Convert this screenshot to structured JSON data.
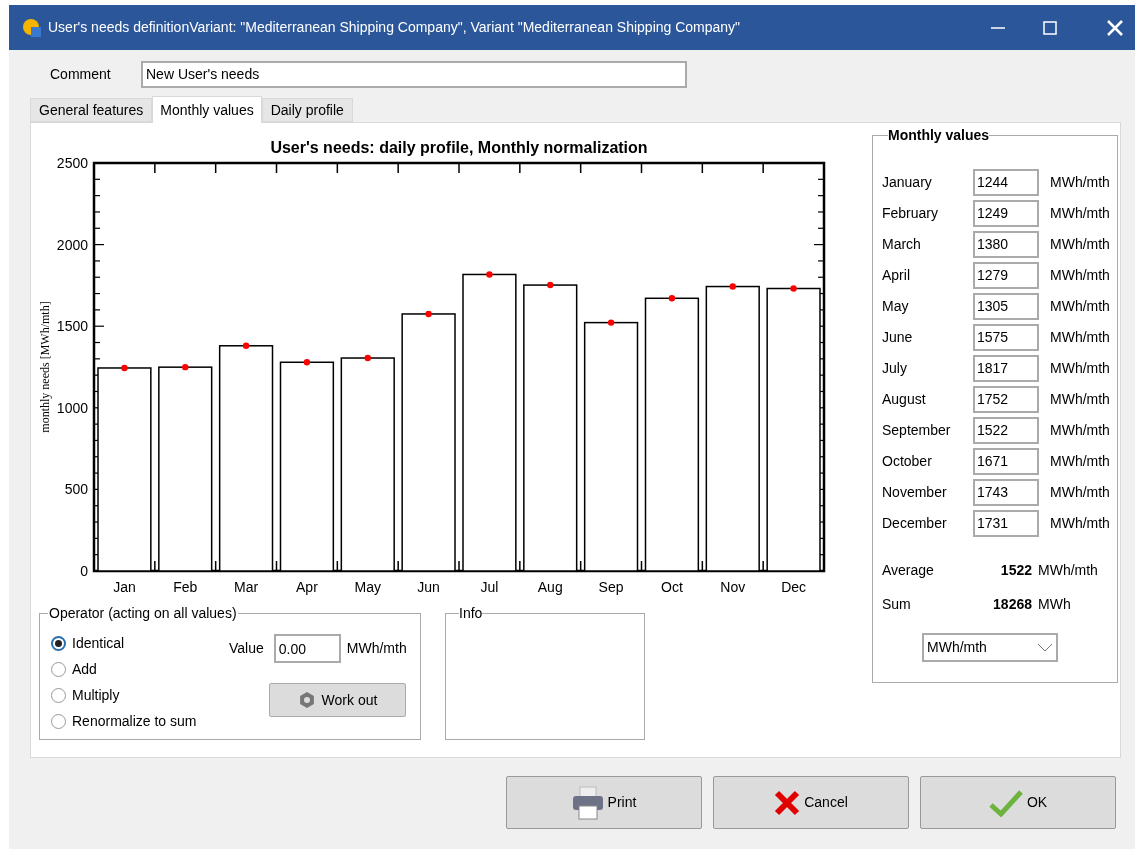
{
  "window": {
    "title": "User's needs definitionVariant:   \"Mediterranean Shipping Company\", Variant  \"Mediterranean Shipping Company\""
  },
  "comment": {
    "label": "Comment",
    "value": "New User's needs"
  },
  "tabs": [
    {
      "label": "General features",
      "selected": false
    },
    {
      "label": "Monthly values",
      "selected": true
    },
    {
      "label": "Daily profile",
      "selected": false
    }
  ],
  "chart": {
    "chart_data": {
      "type": "bar",
      "title": "User's needs: daily profile, Monthly normalization",
      "ylabel": "monthly needs [MWh/mth]",
      "categories": [
        "Jan",
        "Feb",
        "Mar",
        "Apr",
        "May",
        "Jun",
        "Jul",
        "Aug",
        "Sep",
        "Oct",
        "Nov",
        "Dec"
      ],
      "series": [
        {
          "type": "bar",
          "color": "#ffffff",
          "values": [
            1244,
            1249,
            1380,
            1279,
            1305,
            1575,
            1817,
            1752,
            1522,
            1671,
            1743,
            1731
          ]
        },
        {
          "type": "scatter",
          "color": "#ff0000",
          "values": [
            1244,
            1249,
            1380,
            1279,
            1305,
            1575,
            1817,
            1752,
            1522,
            1671,
            1743,
            1731
          ]
        }
      ],
      "ylim": [
        0,
        2500
      ],
      "yticks": [
        0,
        500,
        1000,
        1500,
        2000,
        2500
      ]
    }
  },
  "operator": {
    "title": "Operator (acting on all values)",
    "options": [
      {
        "label": "Identical",
        "selected": true
      },
      {
        "label": "Add",
        "selected": false
      },
      {
        "label": "Multiply",
        "selected": false
      },
      {
        "label": "Renormalize to sum",
        "selected": false
      }
    ],
    "value_label": "Value",
    "value": "0.00",
    "unit": "MWh/mth",
    "button": "Work out"
  },
  "info": {
    "title": "Info"
  },
  "monthly_values": {
    "title": "Monthly values",
    "rows": [
      {
        "month": "January",
        "value": "1244",
        "unit": "MWh/mth"
      },
      {
        "month": "February",
        "value": "1249",
        "unit": "MWh/mth"
      },
      {
        "month": "March",
        "value": "1380",
        "unit": "MWh/mth"
      },
      {
        "month": "April",
        "value": "1279",
        "unit": "MWh/mth"
      },
      {
        "month": "May",
        "value": "1305",
        "unit": "MWh/mth"
      },
      {
        "month": "June",
        "value": "1575",
        "unit": "MWh/mth"
      },
      {
        "month": "July",
        "value": "1817",
        "unit": "MWh/mth"
      },
      {
        "month": "August",
        "value": "1752",
        "unit": "MWh/mth"
      },
      {
        "month": "September",
        "value": "1522",
        "unit": "MWh/mth"
      },
      {
        "month": "October",
        "value": "1671",
        "unit": "MWh/mth"
      },
      {
        "month": "November",
        "value": "1743",
        "unit": "MWh/mth"
      },
      {
        "month": "December",
        "value": "1731",
        "unit": "MWh/mth"
      }
    ],
    "average": {
      "label": "Average",
      "value": "1522",
      "unit": "MWh/mth"
    },
    "sum": {
      "label": "Sum",
      "value": "18268",
      "unit": "MWh"
    },
    "unit_select": "MWh/mth"
  },
  "buttons": [
    {
      "kind": "print",
      "label": "Print"
    },
    {
      "kind": "cancel",
      "label": "Cancel"
    },
    {
      "kind": "ok",
      "label": "OK"
    }
  ]
}
